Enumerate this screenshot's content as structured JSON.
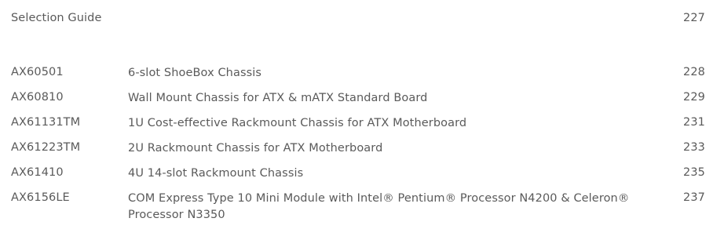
{
  "guide": {
    "label": "Selection Guide",
    "page": "227"
  },
  "entries": [
    {
      "code": "AX60501",
      "title": "6-slot ShoeBox Chassis",
      "page": "228"
    },
    {
      "code": "AX60810",
      "title": "Wall Mount Chassis for ATX & mATX Standard Board",
      "page": "229"
    },
    {
      "code": "AX61131TM",
      "title": "1U Cost-effective Rackmount Chassis for ATX Motherboard",
      "page": "231"
    },
    {
      "code": "AX61223TM",
      "title": "2U Rackmount Chassis for ATX Motherboard",
      "page": "233"
    },
    {
      "code": "AX61410",
      "title": "4U 14-slot Rackmount Chassis",
      "page": "235"
    },
    {
      "code": "AX6156LE",
      "title": "COM Express Type 10 Mini Module with Intel® Pentium® Processor N4200 & Celeron® Processor N3350",
      "page": "237"
    }
  ],
  "colors": {
    "text": "#5a5a5a",
    "background": "#ffffff"
  }
}
